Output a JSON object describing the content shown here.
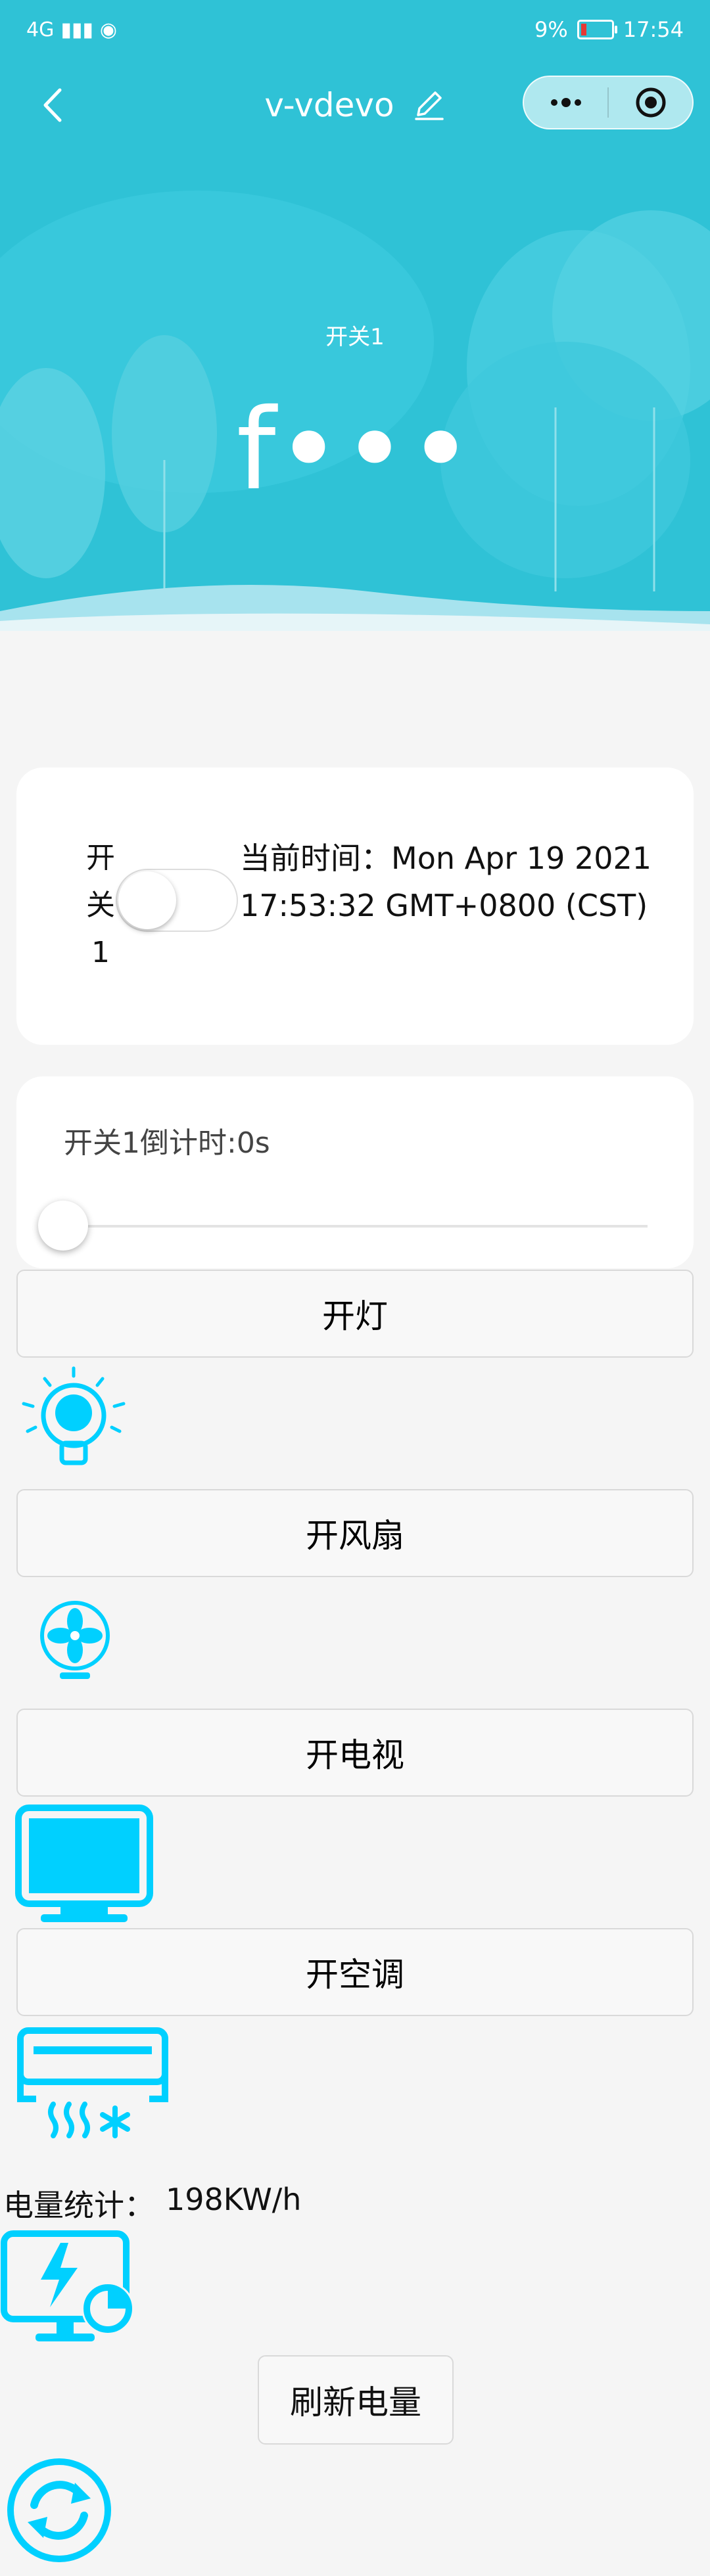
{
  "status_bar": {
    "network": "4G",
    "battery_text": "9%",
    "time": "17:54"
  },
  "nav": {
    "title": "v-vdevo"
  },
  "hero": {
    "switch_name": "开关1",
    "value": "f•••"
  },
  "switch_card": {
    "label": "开\n关\n1",
    "toggle_on": false,
    "time_text": "当前时间：Mon Apr 19 2021 17:53:32 GMT+0800 (CST)"
  },
  "countdown_card": {
    "label": "开关1倒计时:0s",
    "slider_value": 0
  },
  "buttons": {
    "light": "开灯",
    "fan": "开风扇",
    "tv": "开电视",
    "ac": "开空调",
    "refresh": "刷新电量"
  },
  "power": {
    "label": "电量统计：",
    "value": "198KW/h"
  },
  "icons": {
    "light": "light-bulb-icon",
    "fan": "fan-icon",
    "tv": "monitor-icon",
    "ac": "air-conditioner-icon",
    "power": "power-stats-icon",
    "refresh": "refresh-icon"
  },
  "colors": {
    "accent": "#00d0ff",
    "header": "#2ec4d8",
    "header_light": "#4fd0e0"
  }
}
